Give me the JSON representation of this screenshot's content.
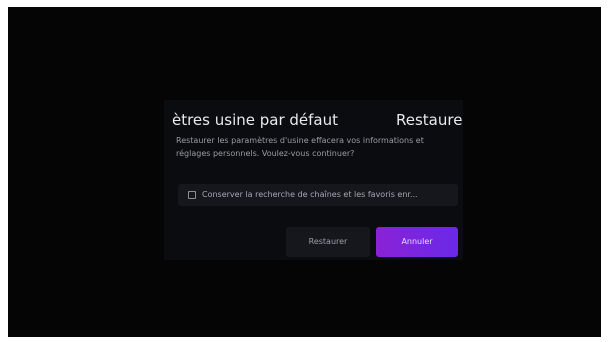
{
  "dialog": {
    "title": "ètres usine par défaut",
    "title_right": "Restaure",
    "message": "Restaurer les paramètres d'usine effacera vos informations et réglages personnels. Voulez-vous continuer?",
    "option": {
      "label": "Conserver la recherche de chaînes et les favoris enr...",
      "checked": false
    },
    "secondary_button": "Restaurer",
    "primary_button": "Annuler"
  },
  "colors": {
    "screen": "#050505",
    "dialog": "#0b0c10",
    "accent_start": "#8a22d6",
    "accent_end": "#6a29e8"
  }
}
